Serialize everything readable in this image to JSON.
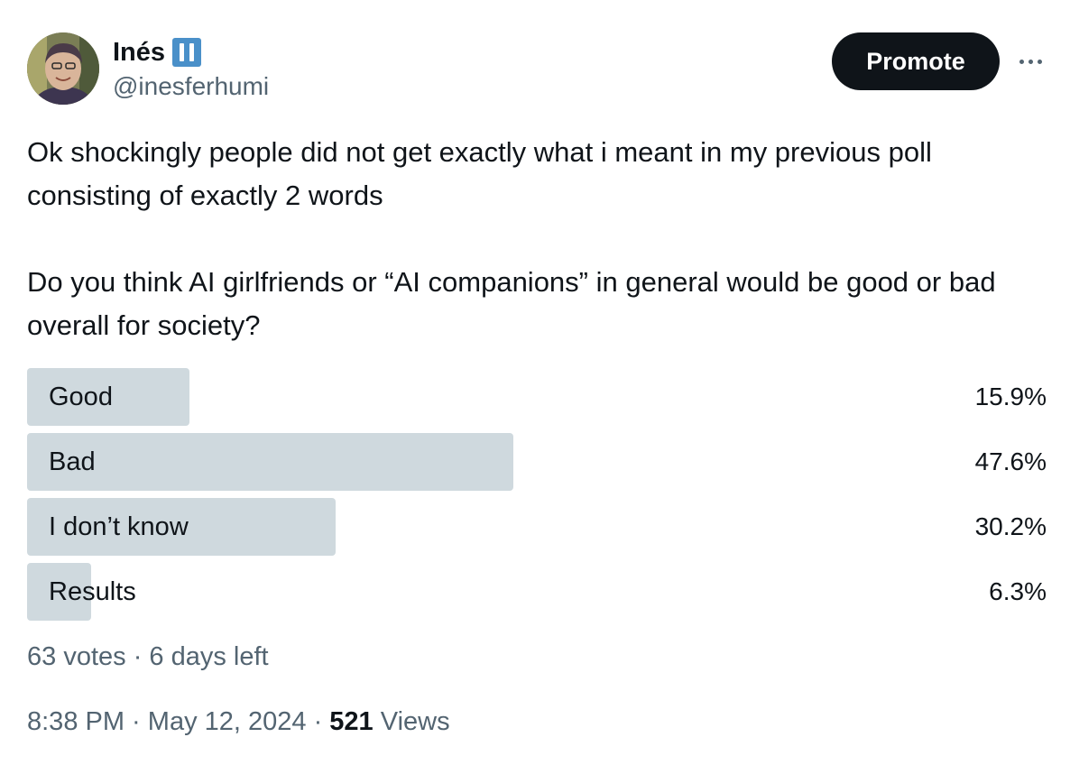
{
  "author": {
    "display_name": "Inés",
    "handle": "@inesferhumi",
    "badge_icon": "pause-badge-icon",
    "badge_color": "#4a90c9"
  },
  "actions": {
    "promote_label": "Promote",
    "more_icon": "more-horizontal-icon"
  },
  "tweet": {
    "paragraph1": "Ok shockingly people did not get exactly what i meant in my previous poll consisting of exactly 2 words",
    "paragraph2": "Do you think AI girlfriends or “AI companions” in general would be good or bad overall for society?"
  },
  "poll": {
    "options": [
      {
        "label": "Good",
        "percent_text": "15.9%",
        "percent": 15.9
      },
      {
        "label": "Bad",
        "percent_text": "47.6%",
        "percent": 47.6
      },
      {
        "label": "I don’t know",
        "percent_text": "30.2%",
        "percent": 30.2
      },
      {
        "label": "Results",
        "percent_text": "6.3%",
        "percent": 6.3
      }
    ],
    "votes": "63 votes",
    "separator": " · ",
    "time_left": "6 days left"
  },
  "footer": {
    "time": "8:38 PM",
    "separator": " · ",
    "date": "May 12, 2024",
    "separator2": " · ",
    "views_count": "521",
    "views_label": " Views"
  },
  "colors": {
    "text_primary": "#0f1419",
    "text_secondary": "#536471",
    "poll_fill": "#cfd9de",
    "button_bg": "#0f1419"
  }
}
